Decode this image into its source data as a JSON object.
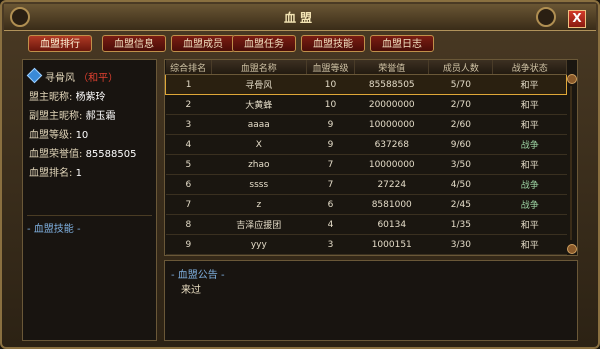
{
  "window": {
    "title": "血盟"
  },
  "tabs": [
    "血盟排行",
    "血盟信息",
    "血盟成员",
    "血盟任务",
    "血盟技能",
    "血盟日志"
  ],
  "guild_info": {
    "name": "寻骨风",
    "status": "（和平）",
    "leader_label": "盟主昵称:",
    "leader": "杨紫玲",
    "vice_label": "副盟主昵称:",
    "vice": "郝玉霜",
    "level_label": "血盟等级:",
    "level": "10",
    "honor_label": "血盟荣誉值:",
    "honor": "85588505",
    "rank_label": "血盟排名:",
    "rank": "1"
  },
  "skills_label": "- 血盟技能 -",
  "table": {
    "headers": [
      "综合排名",
      "血盟名称",
      "血盟等级",
      "荣誉值",
      "成员人数",
      "战争状态"
    ],
    "rows": [
      [
        "1",
        "寻骨风",
        "10",
        "85588505",
        "5/70",
        "和平"
      ],
      [
        "2",
        "大黄蜂",
        "10",
        "20000000",
        "2/70",
        "和平"
      ],
      [
        "3",
        "aaaa",
        "9",
        "10000000",
        "2/60",
        "和平"
      ],
      [
        "4",
        "X",
        "9",
        "637268",
        "9/60",
        "战争"
      ],
      [
        "5",
        "zhao",
        "7",
        "10000000",
        "3/50",
        "和平"
      ],
      [
        "6",
        "ssss",
        "7",
        "27224",
        "4/50",
        "战争"
      ],
      [
        "7",
        "z",
        "6",
        "8581000",
        "2/45",
        "战争"
      ],
      [
        "8",
        "吉泽应援团",
        "4",
        "60134",
        "1/35",
        "和平"
      ],
      [
        "9",
        "yyy",
        "3",
        "1000151",
        "3/30",
        "和平"
      ]
    ]
  },
  "notice": {
    "label": "- 血盟公告 -",
    "text": "来过"
  },
  "close_label": "X"
}
